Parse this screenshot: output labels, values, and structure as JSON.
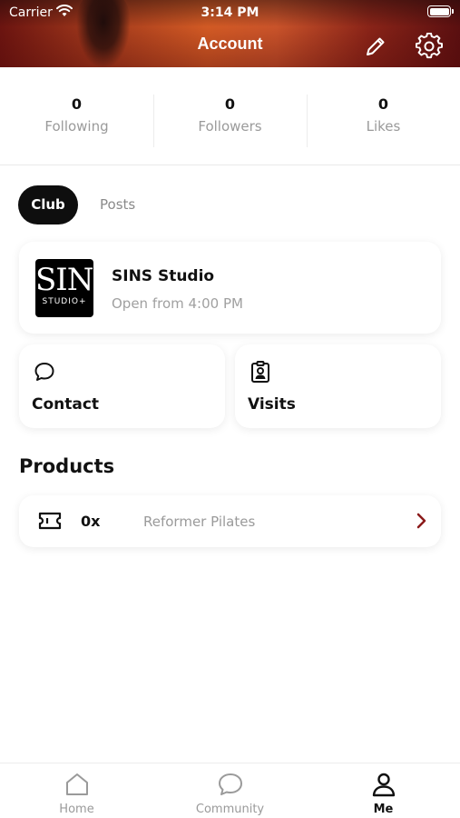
{
  "status_bar": {
    "carrier": "Carrier",
    "time": "3:14 PM"
  },
  "header": {
    "title": "Account"
  },
  "stats": [
    {
      "value": "0",
      "label": "Following"
    },
    {
      "value": "0",
      "label": "Followers"
    },
    {
      "value": "0",
      "label": "Likes"
    }
  ],
  "tabs": {
    "club": "Club",
    "posts": "Posts",
    "active": "Club"
  },
  "club": {
    "logo_big": "SINS",
    "logo_small": "STUDIO+",
    "name": "SINS Studio",
    "hours": "Open from 4:00 PM"
  },
  "tiles": {
    "contact": "Contact",
    "visits": "Visits"
  },
  "products": {
    "title": "Products",
    "items": [
      {
        "qty": "0x",
        "name": "Reformer Pilates"
      }
    ]
  },
  "tabbar": {
    "items": [
      {
        "label": "Home",
        "icon": "home-icon"
      },
      {
        "label": "Community",
        "icon": "chat-bubble-icon"
      },
      {
        "label": "Me",
        "icon": "person-icon"
      }
    ],
    "active": "Me"
  },
  "colors": {
    "accent": "#8b1a1a",
    "dark": "#0e0e0e",
    "muted": "#9a9a9a"
  }
}
